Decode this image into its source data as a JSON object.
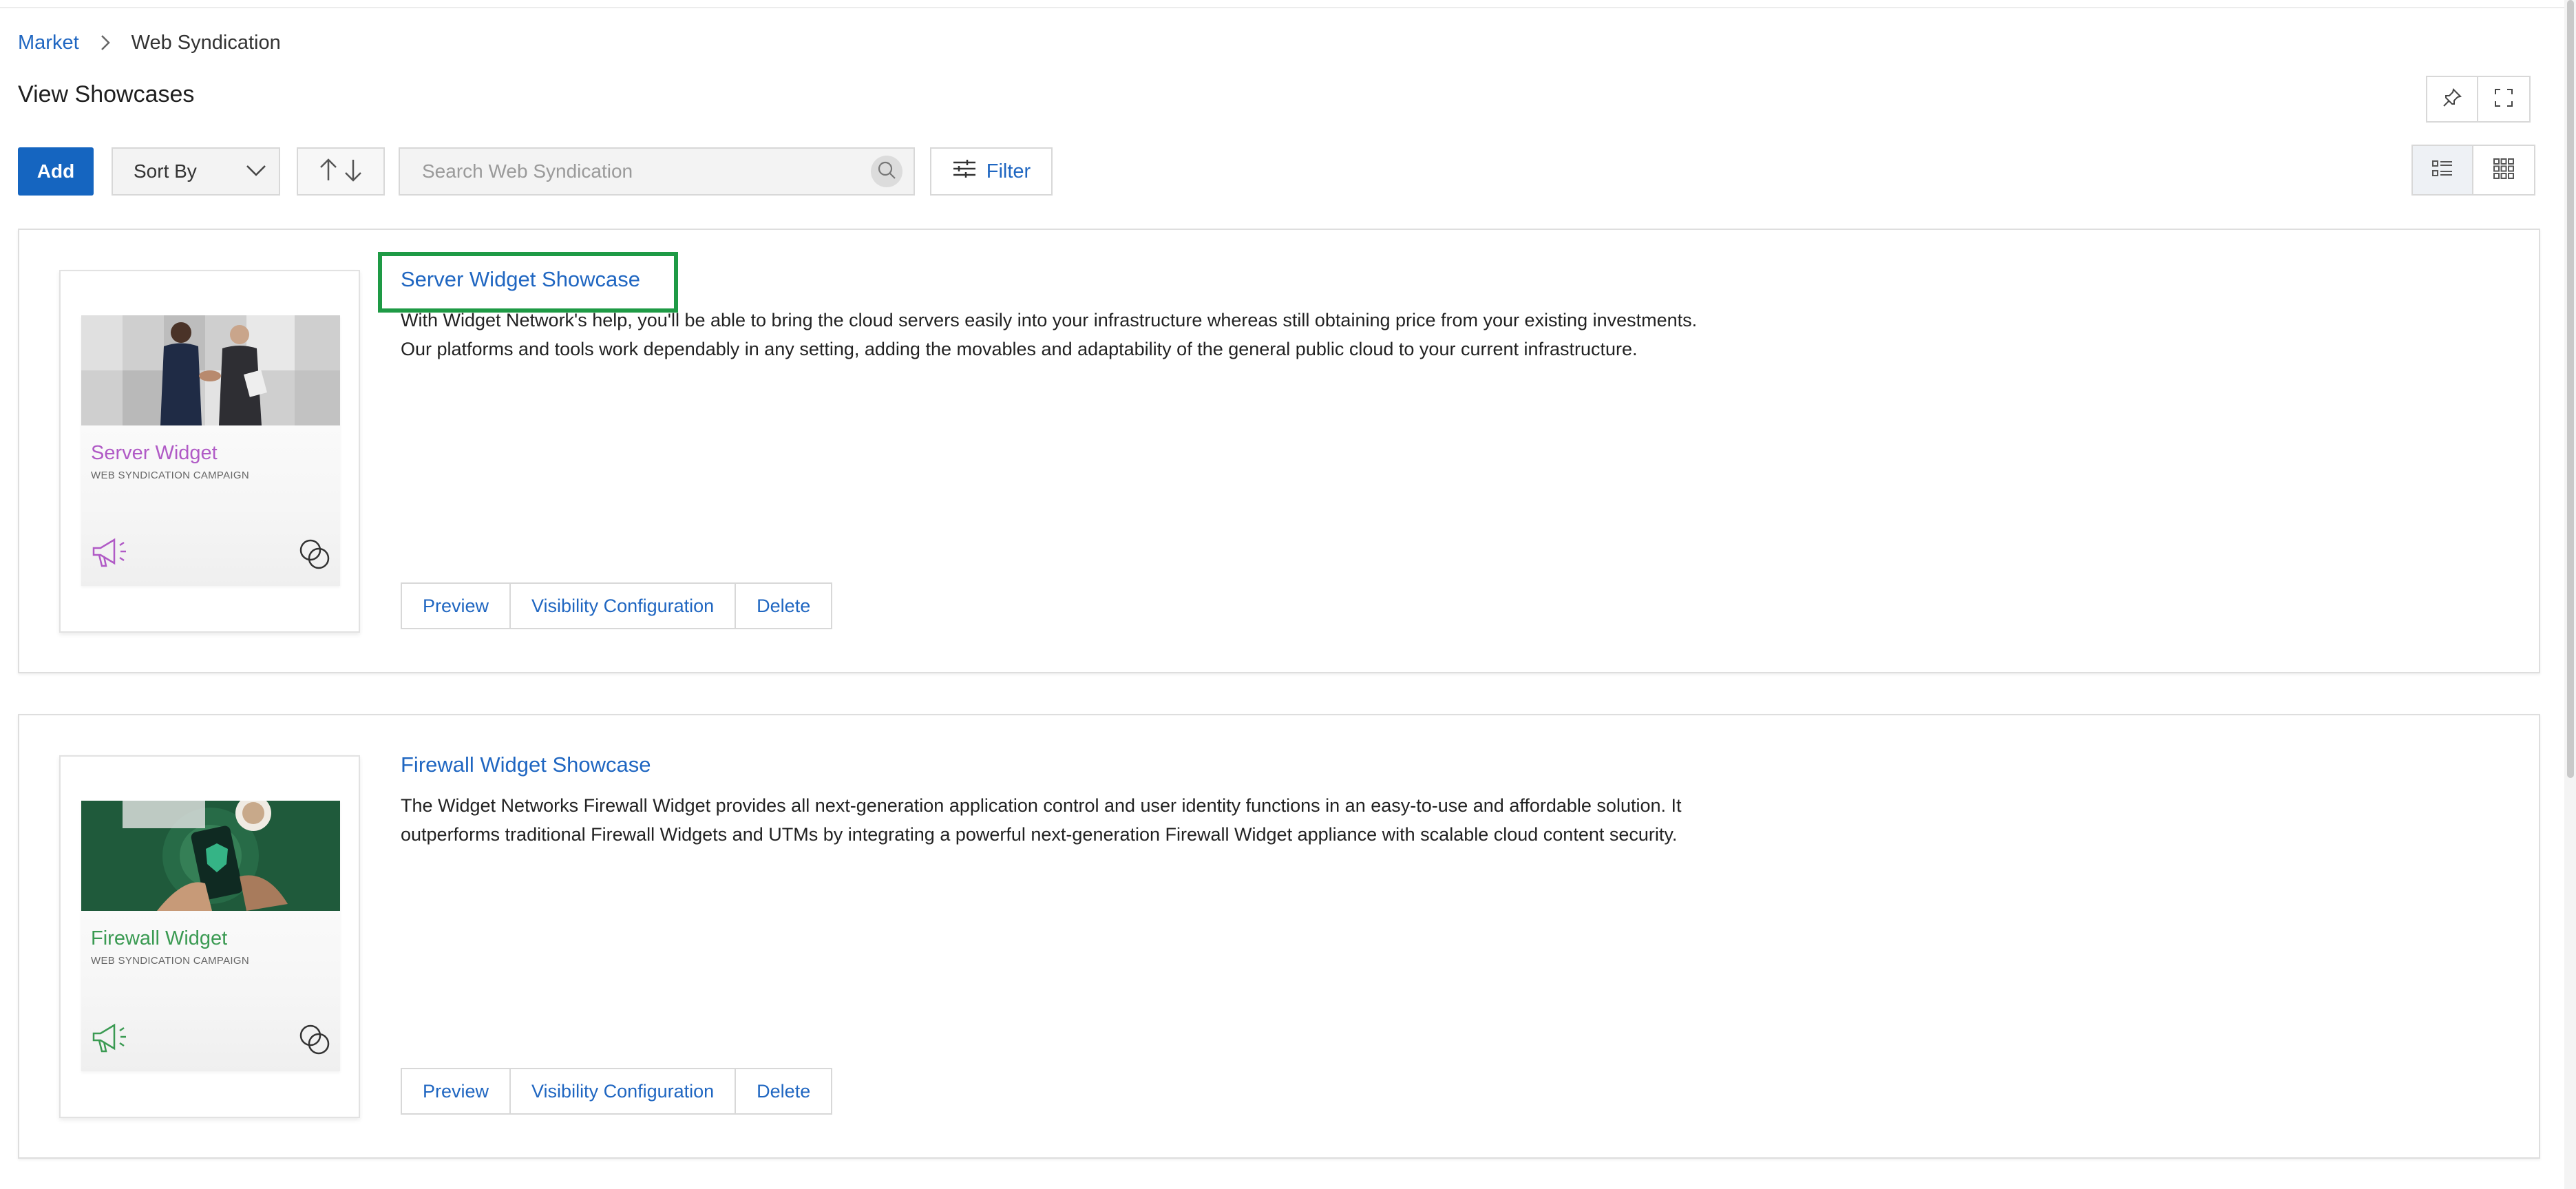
{
  "breadcrumb": {
    "root": "Market",
    "current": "Web Syndication"
  },
  "page_title": "View Showcases",
  "toolbar": {
    "add_label": "Add",
    "sort_label": "Sort By",
    "search_placeholder": "Search Web Syndication",
    "filter_label": "Filter"
  },
  "colors": {
    "accent": "#1565c0",
    "link": "#1f66c1",
    "highlight": "#1e9a45"
  },
  "showcases": [
    {
      "title": "Server Widget Showcase",
      "description": "With Widget Network's help, you'll be able to bring the cloud servers easily into your infrastructure whereas still obtaining price from your existing investments. Our platforms and tools work dependably in any setting, adding the movables and adaptability of the general public cloud to your current infrastructure.",
      "thumb_title": "Server Widget",
      "thumb_subtitle": "WEB SYNDICATION CAMPAIGN",
      "thumb_color": "#b05ac6",
      "actions": {
        "preview": "Preview",
        "visibility": "Visibility Configuration",
        "delete": "Delete"
      }
    },
    {
      "title": "Firewall Widget Showcase",
      "description": "The Widget Networks Firewall Widget provides all next-generation application control and user identity functions in an easy-to-use and affordable solution. It outperforms traditional Firewall Widgets and UTMs by integrating a powerful next-generation Firewall Widget appliance with scalable cloud content security.",
      "thumb_title": "Firewall Widget",
      "thumb_subtitle": "WEB SYNDICATION CAMPAIGN",
      "thumb_color": "#3a9a52",
      "actions": {
        "preview": "Preview",
        "visibility": "Visibility Configuration",
        "delete": "Delete"
      }
    }
  ]
}
